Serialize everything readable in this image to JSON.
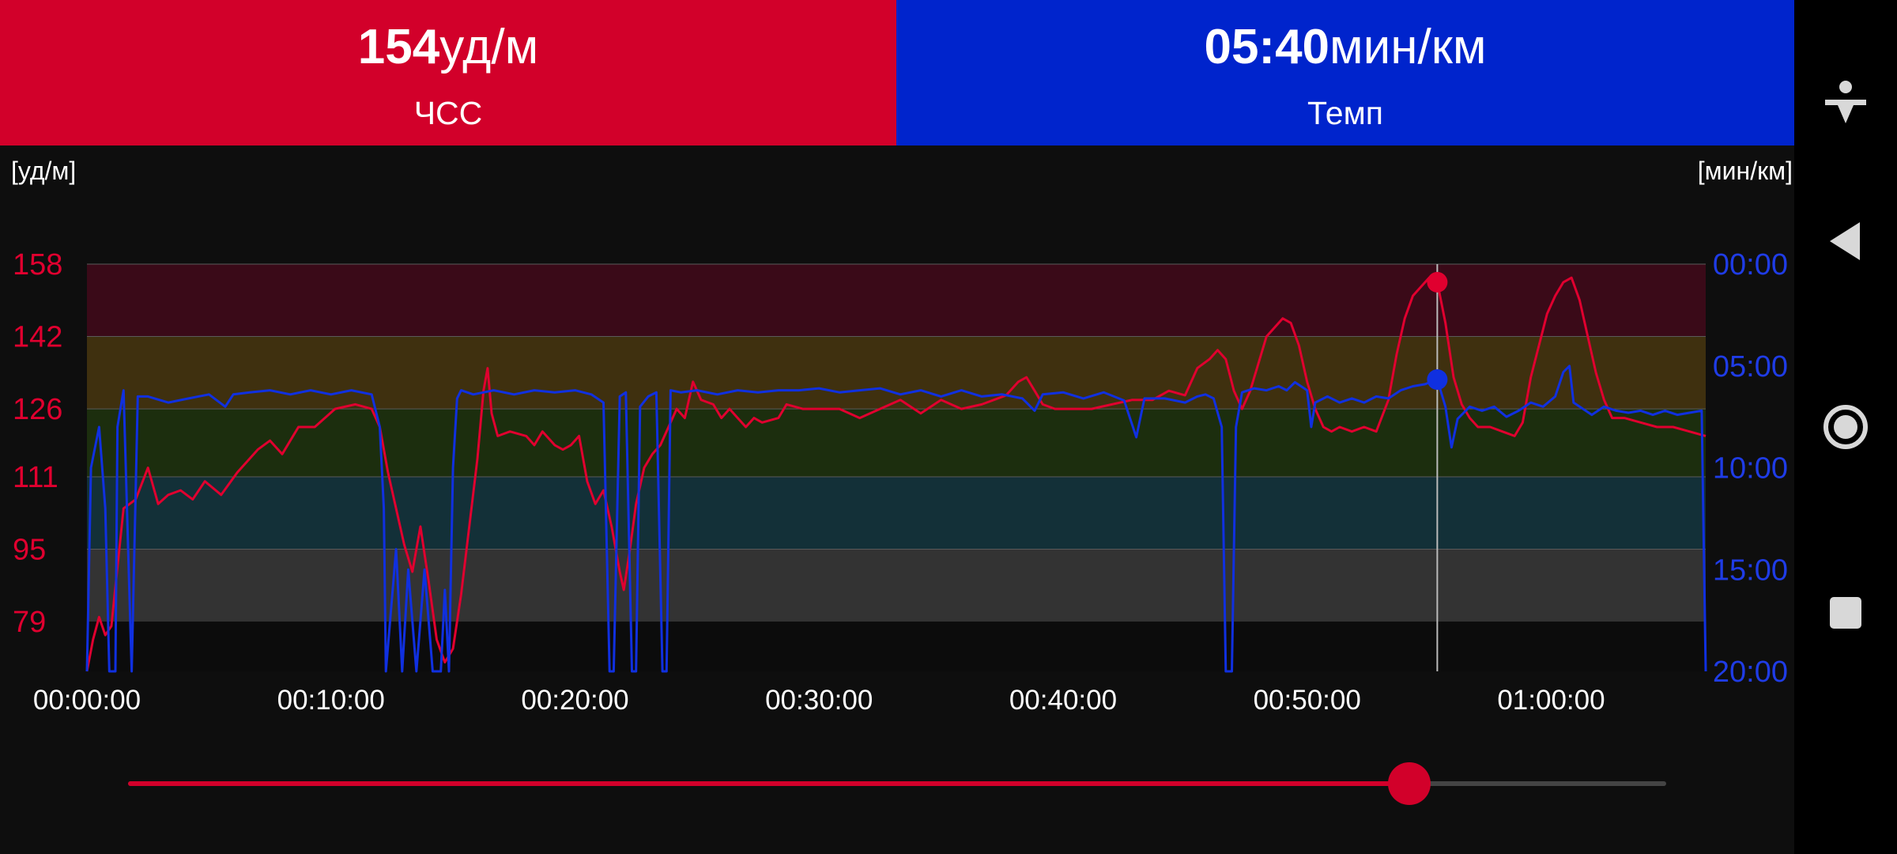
{
  "tiles": {
    "heart_rate": {
      "value": "154",
      "unit": "уд/м",
      "label": "ЧСС",
      "color": "#d2002a"
    },
    "pace": {
      "value": "05:40",
      "unit": "мин/км",
      "label": "Темп",
      "color": "#0024cc"
    }
  },
  "navbar": {
    "icons": [
      "accessibility-icon",
      "back-icon",
      "home-icon",
      "recents-icon"
    ]
  },
  "slider": {
    "fraction": 0.834,
    "active_color": "#d2002a",
    "inactive_color": "#444444"
  },
  "chart_data": {
    "type": "line",
    "title": "",
    "left_axis_label": "[уд/м]",
    "right_axis_label": "[мин/км]",
    "x_ticks": [
      "00:00:00",
      "00:10:00",
      "00:20:00",
      "00:30:00",
      "00:40:00",
      "00:50:00",
      "01:00:00"
    ],
    "x_tick_seconds": [
      0,
      600,
      1200,
      1800,
      2400,
      3000,
      3600
    ],
    "x_range_seconds": [
      0,
      3980
    ],
    "hr_axis": {
      "ticks": [
        158,
        142,
        126,
        111,
        95,
        79
      ],
      "range": [
        68,
        158
      ]
    },
    "pace_axis": {
      "ticks": [
        "00:00",
        "05:00",
        "10:00",
        "15:00",
        "20:00"
      ],
      "range_min": [
        0,
        20
      ]
    },
    "zones": [
      {
        "from": 142,
        "to": 158,
        "color": "#3a0a18"
      },
      {
        "from": 126,
        "to": 142,
        "color": "#3f300f"
      },
      {
        "from": 111,
        "to": 126,
        "color": "#1c2e0e"
      },
      {
        "from": 95,
        "to": 111,
        "color": "#133038"
      },
      {
        "from": 79,
        "to": 95,
        "color": "#333333"
      }
    ],
    "cursor": {
      "time_s": 3320,
      "hr": 154,
      "pace_min": 5.67
    },
    "series": [
      {
        "name": "ЧСС",
        "axis": "hr",
        "color": "#e0002f",
        "points": [
          [
            0,
            68
          ],
          [
            15,
            75
          ],
          [
            30,
            80
          ],
          [
            45,
            76
          ],
          [
            60,
            78
          ],
          [
            90,
            104
          ],
          [
            120,
            106
          ],
          [
            150,
            113
          ],
          [
            175,
            105
          ],
          [
            200,
            107
          ],
          [
            230,
            108
          ],
          [
            260,
            106
          ],
          [
            290,
            110
          ],
          [
            330,
            107
          ],
          [
            370,
            112
          ],
          [
            400,
            115
          ],
          [
            420,
            117
          ],
          [
            450,
            119
          ],
          [
            480,
            116
          ],
          [
            520,
            122
          ],
          [
            560,
            122
          ],
          [
            610,
            126
          ],
          [
            660,
            127
          ],
          [
            700,
            126
          ],
          [
            720,
            122
          ],
          [
            740,
            112
          ],
          [
            760,
            104
          ],
          [
            780,
            96
          ],
          [
            800,
            90
          ],
          [
            820,
            100
          ],
          [
            840,
            88
          ],
          [
            860,
            75
          ],
          [
            880,
            70
          ],
          [
            900,
            73
          ],
          [
            920,
            85
          ],
          [
            940,
            100
          ],
          [
            960,
            115
          ],
          [
            975,
            130
          ],
          [
            985,
            135
          ],
          [
            995,
            125
          ],
          [
            1010,
            120
          ],
          [
            1040,
            121
          ],
          [
            1080,
            120
          ],
          [
            1100,
            118
          ],
          [
            1120,
            121
          ],
          [
            1150,
            118
          ],
          [
            1170,
            117
          ],
          [
            1190,
            118
          ],
          [
            1210,
            120
          ],
          [
            1230,
            110
          ],
          [
            1250,
            105
          ],
          [
            1270,
            108
          ],
          [
            1290,
            100
          ],
          [
            1310,
            90
          ],
          [
            1320,
            86
          ],
          [
            1335,
            95
          ],
          [
            1350,
            105
          ],
          [
            1370,
            113
          ],
          [
            1390,
            116
          ],
          [
            1410,
            118
          ],
          [
            1430,
            122
          ],
          [
            1450,
            126
          ],
          [
            1470,
            124
          ],
          [
            1490,
            132
          ],
          [
            1510,
            128
          ],
          [
            1540,
            127
          ],
          [
            1560,
            124
          ],
          [
            1580,
            126
          ],
          [
            1600,
            124
          ],
          [
            1620,
            122
          ],
          [
            1640,
            124
          ],
          [
            1660,
            123
          ],
          [
            1700,
            124
          ],
          [
            1720,
            127
          ],
          [
            1760,
            126
          ],
          [
            1800,
            126
          ],
          [
            1850,
            126
          ],
          [
            1900,
            124
          ],
          [
            1950,
            126
          ],
          [
            2000,
            128
          ],
          [
            2050,
            125
          ],
          [
            2100,
            128
          ],
          [
            2150,
            126
          ],
          [
            2200,
            127
          ],
          [
            2230,
            128
          ],
          [
            2260,
            129
          ],
          [
            2290,
            132
          ],
          [
            2310,
            133
          ],
          [
            2330,
            130
          ],
          [
            2350,
            127
          ],
          [
            2380,
            126
          ],
          [
            2420,
            126
          ],
          [
            2470,
            126
          ],
          [
            2520,
            127
          ],
          [
            2570,
            128
          ],
          [
            2620,
            128
          ],
          [
            2660,
            130
          ],
          [
            2700,
            129
          ],
          [
            2730,
            135
          ],
          [
            2760,
            137
          ],
          [
            2780,
            139
          ],
          [
            2800,
            137
          ],
          [
            2820,
            130
          ],
          [
            2840,
            126
          ],
          [
            2860,
            130
          ],
          [
            2880,
            136
          ],
          [
            2900,
            142
          ],
          [
            2920,
            144
          ],
          [
            2940,
            146
          ],
          [
            2960,
            145
          ],
          [
            2980,
            140
          ],
          [
            3000,
            132
          ],
          [
            3020,
            126
          ],
          [
            3040,
            122
          ],
          [
            3060,
            121
          ],
          [
            3080,
            122
          ],
          [
            3110,
            121
          ],
          [
            3140,
            122
          ],
          [
            3170,
            121
          ],
          [
            3200,
            128
          ],
          [
            3220,
            138
          ],
          [
            3240,
            146
          ],
          [
            3260,
            151
          ],
          [
            3280,
            153
          ],
          [
            3300,
            155
          ],
          [
            3320,
            154
          ],
          [
            3340,
            145
          ],
          [
            3360,
            133
          ],
          [
            3380,
            127
          ],
          [
            3400,
            124
          ],
          [
            3420,
            122
          ],
          [
            3450,
            122
          ],
          [
            3480,
            121
          ],
          [
            3510,
            120
          ],
          [
            3530,
            123
          ],
          [
            3550,
            133
          ],
          [
            3570,
            140
          ],
          [
            3590,
            147
          ],
          [
            3610,
            151
          ],
          [
            3630,
            154
          ],
          [
            3650,
            155
          ],
          [
            3670,
            150
          ],
          [
            3690,
            142
          ],
          [
            3710,
            134
          ],
          [
            3730,
            128
          ],
          [
            3750,
            124
          ],
          [
            3780,
            124
          ],
          [
            3820,
            123
          ],
          [
            3860,
            122
          ],
          [
            3900,
            122
          ],
          [
            3940,
            121
          ],
          [
            3980,
            120
          ]
        ]
      },
      {
        "name": "Темп",
        "axis": "pace",
        "color": "#1030e0",
        "points": [
          [
            0,
            20
          ],
          [
            10,
            10
          ],
          [
            30,
            8
          ],
          [
            45,
            12
          ],
          [
            55,
            20
          ],
          [
            70,
            20
          ],
          [
            75,
            8
          ],
          [
            90,
            6.2
          ],
          [
            110,
            20
          ],
          [
            125,
            6.5
          ],
          [
            150,
            6.5
          ],
          [
            200,
            6.8
          ],
          [
            250,
            6.6
          ],
          [
            300,
            6.4
          ],
          [
            340,
            7
          ],
          [
            360,
            6.4
          ],
          [
            400,
            6.3
          ],
          [
            450,
            6.2
          ],
          [
            500,
            6.4
          ],
          [
            550,
            6.2
          ],
          [
            600,
            6.4
          ],
          [
            650,
            6.2
          ],
          [
            700,
            6.4
          ],
          [
            720,
            8
          ],
          [
            730,
            12
          ],
          [
            735,
            20
          ],
          [
            760,
            14
          ],
          [
            775,
            20
          ],
          [
            790,
            15
          ],
          [
            810,
            20
          ],
          [
            830,
            15
          ],
          [
            850,
            20
          ],
          [
            870,
            20
          ],
          [
            880,
            16
          ],
          [
            890,
            20
          ],
          [
            900,
            10
          ],
          [
            910,
            6.6
          ],
          [
            920,
            6.2
          ],
          [
            950,
            6.4
          ],
          [
            1000,
            6.2
          ],
          [
            1050,
            6.4
          ],
          [
            1100,
            6.2
          ],
          [
            1150,
            6.3
          ],
          [
            1200,
            6.2
          ],
          [
            1240,
            6.4
          ],
          [
            1270,
            6.8
          ],
          [
            1285,
            20
          ],
          [
            1295,
            20
          ],
          [
            1310,
            6.5
          ],
          [
            1325,
            6.3
          ],
          [
            1340,
            20
          ],
          [
            1350,
            20
          ],
          [
            1360,
            7
          ],
          [
            1380,
            6.5
          ],
          [
            1400,
            6.3
          ],
          [
            1415,
            20
          ],
          [
            1425,
            20
          ],
          [
            1435,
            6.2
          ],
          [
            1460,
            6.3
          ],
          [
            1500,
            6.2
          ],
          [
            1550,
            6.4
          ],
          [
            1600,
            6.2
          ],
          [
            1650,
            6.3
          ],
          [
            1700,
            6.2
          ],
          [
            1750,
            6.2
          ],
          [
            1800,
            6.1
          ],
          [
            1850,
            6.3
          ],
          [
            1900,
            6.2
          ],
          [
            1950,
            6.1
          ],
          [
            2000,
            6.4
          ],
          [
            2050,
            6.2
          ],
          [
            2100,
            6.5
          ],
          [
            2150,
            6.2
          ],
          [
            2200,
            6.5
          ],
          [
            2250,
            6.4
          ],
          [
            2300,
            6.6
          ],
          [
            2330,
            7.2
          ],
          [
            2350,
            6.4
          ],
          [
            2400,
            6.3
          ],
          [
            2450,
            6.6
          ],
          [
            2500,
            6.3
          ],
          [
            2550,
            6.7
          ],
          [
            2580,
            8.5
          ],
          [
            2600,
            6.6
          ],
          [
            2650,
            6.6
          ],
          [
            2700,
            6.8
          ],
          [
            2730,
            6.5
          ],
          [
            2750,
            6.4
          ],
          [
            2770,
            6.6
          ],
          [
            2790,
            8
          ],
          [
            2800,
            20
          ],
          [
            2815,
            20
          ],
          [
            2825,
            8
          ],
          [
            2840,
            6.3
          ],
          [
            2870,
            6.1
          ],
          [
            2900,
            6.2
          ],
          [
            2930,
            6.0
          ],
          [
            2950,
            6.2
          ],
          [
            2970,
            5.8
          ],
          [
            3000,
            6.2
          ],
          [
            3010,
            8
          ],
          [
            3020,
            6.8
          ],
          [
            3050,
            6.5
          ],
          [
            3080,
            6.8
          ],
          [
            3110,
            6.6
          ],
          [
            3140,
            6.8
          ],
          [
            3170,
            6.5
          ],
          [
            3200,
            6.6
          ],
          [
            3230,
            6.2
          ],
          [
            3260,
            6.0
          ],
          [
            3290,
            5.9
          ],
          [
            3320,
            5.67
          ],
          [
            3340,
            7
          ],
          [
            3355,
            9
          ],
          [
            3370,
            7.6
          ],
          [
            3400,
            7.0
          ],
          [
            3430,
            7.2
          ],
          [
            3460,
            7.0
          ],
          [
            3490,
            7.5
          ],
          [
            3520,
            7.2
          ],
          [
            3550,
            6.8
          ],
          [
            3580,
            7.0
          ],
          [
            3610,
            6.5
          ],
          [
            3630,
            5.3
          ],
          [
            3645,
            5.0
          ],
          [
            3655,
            6.8
          ],
          [
            3670,
            7.0
          ],
          [
            3700,
            7.4
          ],
          [
            3730,
            7.0
          ],
          [
            3760,
            7.2
          ],
          [
            3790,
            7.3
          ],
          [
            3820,
            7.2
          ],
          [
            3850,
            7.4
          ],
          [
            3880,
            7.2
          ],
          [
            3910,
            7.4
          ],
          [
            3940,
            7.3
          ],
          [
            3970,
            7.2
          ],
          [
            3980,
            20
          ]
        ]
      }
    ]
  }
}
